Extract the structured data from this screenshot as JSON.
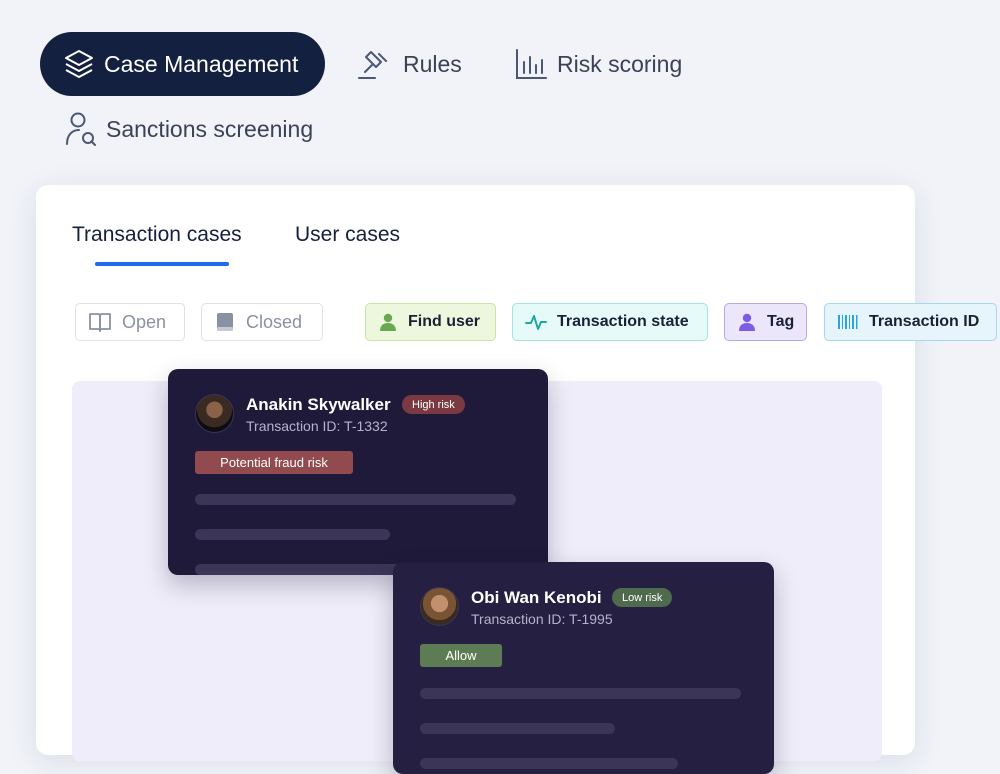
{
  "nav": {
    "items": [
      {
        "label": "Case Management",
        "icon": "layers-icon",
        "active": true
      },
      {
        "label": "Rules",
        "icon": "gavel-icon",
        "active": false
      },
      {
        "label": "Risk scoring",
        "icon": "bar-chart-icon",
        "active": false
      },
      {
        "label": "Sanctions screening",
        "icon": "user-search-icon",
        "active": false
      }
    ]
  },
  "tabs": [
    {
      "label": "Transaction cases",
      "active": true
    },
    {
      "label": "User cases",
      "active": false
    }
  ],
  "filters": [
    {
      "label": "Open",
      "icon": "open-book-icon"
    },
    {
      "label": "Closed",
      "icon": "closed-book-icon"
    }
  ],
  "chips": [
    {
      "label": "Find user",
      "icon": "user-icon",
      "color": "#6aa84f"
    },
    {
      "label": "Transaction state",
      "icon": "activity-icon",
      "color": "#1fa8a0"
    },
    {
      "label": "Tag",
      "icon": "person-icon",
      "color": "#7c5ce6"
    },
    {
      "label": "Transaction ID",
      "icon": "barcode-icon",
      "color": "#2aa3d8"
    }
  ],
  "cases": [
    {
      "name": "Anakin Skywalker",
      "transaction": "Transaction ID: T-1332",
      "risk": "High risk",
      "status": "Potential fraud risk"
    },
    {
      "name": "Obi Wan Kenobi",
      "transaction": "Transaction ID: T-1995",
      "risk": "Low risk",
      "status": "Allow"
    }
  ],
  "colors": {
    "nav_active_bg": "#14203f",
    "tab_underline": "#1f6bf0",
    "card_bg": "#201a3a",
    "high_risk": "#914a4d",
    "low_risk": "#5e7c53"
  }
}
